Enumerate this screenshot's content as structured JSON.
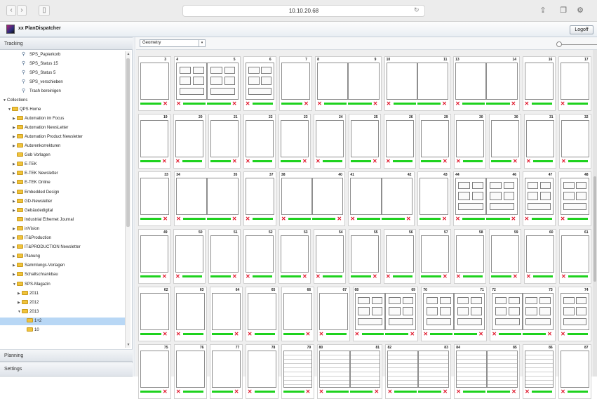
{
  "browser": {
    "back_icon": "back-arrow-icon",
    "forward_icon": "forward-arrow-icon",
    "sidebar_icon": "sidebar-toggle-icon",
    "url": "10.10.20.68",
    "reload_icon": "reload-icon",
    "share_icon": "share-icon",
    "tabs_icon": "tabs-icon",
    "settings_icon": "gear-icon"
  },
  "app": {
    "title": "xx PlanDispatcher",
    "logoff_label": "Logoff"
  },
  "sidebar": {
    "sections": [
      {
        "label": "Tracking"
      },
      {
        "label": "Planning"
      },
      {
        "label": "Settings"
      }
    ],
    "tree": [
      {
        "label": "SPS_Papierkorb",
        "kind": "search",
        "depth": 3
      },
      {
        "label": "SPS_Status 15",
        "kind": "search",
        "depth": 3
      },
      {
        "label": "SPS_Status 5",
        "kind": "search",
        "depth": 3
      },
      {
        "label": "SPS_verschieben",
        "kind": "search",
        "depth": 3
      },
      {
        "label": "Trash bereinigen",
        "kind": "search",
        "depth": 3
      },
      {
        "label": "Collections",
        "kind": "text",
        "depth": 0,
        "arrow": "open"
      },
      {
        "label": "QPS Home",
        "kind": "folder",
        "depth": 1,
        "arrow": "open"
      },
      {
        "label": "Automation im Focus",
        "kind": "folder",
        "depth": 2,
        "arrow": "closed"
      },
      {
        "label": "Automation NewsLetter",
        "kind": "folder",
        "depth": 2,
        "arrow": "closed"
      },
      {
        "label": "Automation Product Newsletter",
        "kind": "folder",
        "depth": 2,
        "arrow": "closed"
      },
      {
        "label": "Autorenkorrekturen",
        "kind": "folder",
        "depth": 2,
        "arrow": "closed"
      },
      {
        "label": "Gob Vorlagen",
        "kind": "folder",
        "depth": 2,
        "arrow": "none"
      },
      {
        "label": "E-TEK",
        "kind": "folder",
        "depth": 2,
        "arrow": "closed"
      },
      {
        "label": "E-TEK Newsletter",
        "kind": "folder",
        "depth": 2,
        "arrow": "closed"
      },
      {
        "label": "E-TEK Online",
        "kind": "folder",
        "depth": 2,
        "arrow": "closed"
      },
      {
        "label": "Embedded Design",
        "kind": "folder",
        "depth": 2,
        "arrow": "closed"
      },
      {
        "label": "GD-Newsletter",
        "kind": "folder",
        "depth": 2,
        "arrow": "closed"
      },
      {
        "label": "Gebäudedigital",
        "kind": "folder",
        "depth": 2,
        "arrow": "closed"
      },
      {
        "label": "Industrial Ethernet Journal",
        "kind": "folder",
        "depth": 2,
        "arrow": "none"
      },
      {
        "label": "inVision",
        "kind": "folder",
        "depth": 2,
        "arrow": "closed"
      },
      {
        "label": "IT&Production",
        "kind": "folder",
        "depth": 2,
        "arrow": "closed"
      },
      {
        "label": "IT&PRODUCTION Newsletter",
        "kind": "folder",
        "depth": 2,
        "arrow": "closed"
      },
      {
        "label": "Planung",
        "kind": "folder",
        "depth": 2,
        "arrow": "closed"
      },
      {
        "label": "Sammlungs-Vorlagen",
        "kind": "folder",
        "depth": 2,
        "arrow": "closed"
      },
      {
        "label": "Schaltschrankbau",
        "kind": "folder",
        "depth": 2,
        "arrow": "closed"
      },
      {
        "label": "SPS-Magazin",
        "kind": "folder",
        "depth": 2,
        "arrow": "open"
      },
      {
        "label": "2011",
        "kind": "folder",
        "depth": 3,
        "arrow": "closed"
      },
      {
        "label": "2012",
        "kind": "folder",
        "depth": 3,
        "arrow": "closed"
      },
      {
        "label": "2013",
        "kind": "folder",
        "depth": 3,
        "arrow": "open"
      },
      {
        "label": "1+2",
        "kind": "folder",
        "depth": 4,
        "arrow": "none",
        "selected": true
      },
      {
        "label": "10",
        "kind": "folder",
        "depth": 4,
        "arrow": "none"
      }
    ]
  },
  "toolbar": {
    "view_mode": "Geometry",
    "dropdown_icon": "chevron-down-icon",
    "zoom_slider_value": 0
  },
  "spread_rows": [
    [
      {
        "labels": [
          "3"
        ],
        "pages": 1,
        "ok": [
          true
        ]
      },
      {
        "labels": [
          "4",
          "5"
        ],
        "pages": 2,
        "ok": [
          false,
          true
        ],
        "layout": true
      },
      {
        "labels": [
          "6"
        ],
        "pages": 1,
        "ok": [
          false
        ],
        "layout": true
      },
      {
        "labels": [
          "7"
        ],
        "pages": 1,
        "ok": [
          true
        ]
      },
      {
        "labels": [
          "8",
          "9"
        ],
        "pages": 2,
        "ok": [
          false,
          true
        ]
      },
      {
        "labels": [
          "10",
          "11"
        ],
        "pages": 2,
        "ok": [
          false,
          true
        ]
      },
      {
        "labels": [
          "13",
          "14"
        ],
        "pages": 2,
        "ok": [
          false,
          true
        ]
      },
      {
        "labels": [
          "16"
        ],
        "pages": 1,
        "ok": [
          false
        ]
      },
      {
        "labels": [
          "17"
        ],
        "pages": 1,
        "ok": [
          false
        ]
      }
    ],
    [
      {
        "labels": [
          "19"
        ],
        "pages": 1,
        "ok": [
          true
        ]
      },
      {
        "labels": [
          "20"
        ],
        "pages": 1,
        "ok": [
          false
        ]
      },
      {
        "labels": [
          "21"
        ],
        "pages": 1,
        "ok": [
          true
        ]
      },
      {
        "labels": [
          "22"
        ],
        "pages": 1,
        "ok": [
          false
        ]
      },
      {
        "labels": [
          "23"
        ],
        "pages": 1,
        "ok": [
          true
        ]
      },
      {
        "labels": [
          "24"
        ],
        "pages": 1,
        "ok": [
          false
        ]
      },
      {
        "labels": [
          "25"
        ],
        "pages": 1,
        "ok": [
          true
        ]
      },
      {
        "labels": [
          "26"
        ],
        "pages": 1,
        "ok": [
          false
        ]
      },
      {
        "labels": [
          "29"
        ],
        "pages": 1,
        "ok": [
          true
        ]
      },
      {
        "labels": [
          "30"
        ],
        "pages": 1,
        "ok": [
          false
        ]
      },
      {
        "labels": [
          "30"
        ],
        "pages": 1,
        "ok": [
          true
        ]
      },
      {
        "labels": [
          "31"
        ],
        "pages": 1,
        "ok": [
          false
        ]
      },
      {
        "labels": [
          "32"
        ],
        "pages": 1,
        "ok": [
          false
        ]
      }
    ],
    [
      {
        "labels": [
          "33"
        ],
        "pages": 1,
        "ok": [
          true
        ]
      },
      {
        "labels": [
          "34",
          "35"
        ],
        "pages": 2,
        "ok": [
          false,
          true
        ]
      },
      {
        "labels": [
          "37"
        ],
        "pages": 1,
        "ok": [
          false
        ]
      },
      {
        "labels": [
          "38",
          "40"
        ],
        "pages": 2,
        "ok": [
          false,
          true
        ]
      },
      {
        "labels": [
          "41",
          "42"
        ],
        "pages": 2,
        "ok": [
          false,
          true
        ]
      },
      {
        "labels": [
          "43"
        ],
        "pages": 1,
        "ok": [
          true
        ]
      },
      {
        "labels": [
          "44",
          "46"
        ],
        "pages": 2,
        "ok": [
          false,
          true
        ],
        "layout": true
      },
      {
        "labels": [
          "47"
        ],
        "pages": 1,
        "ok": [
          false
        ],
        "layout": true
      },
      {
        "labels": [
          "48"
        ],
        "pages": 1,
        "ok": [
          false
        ],
        "layout": true
      }
    ],
    [
      {
        "labels": [
          "49"
        ],
        "pages": 1,
        "ok": [
          true
        ]
      },
      {
        "labels": [
          "50"
        ],
        "pages": 1,
        "ok": [
          false
        ]
      },
      {
        "labels": [
          "51"
        ],
        "pages": 1,
        "ok": [
          true
        ]
      },
      {
        "labels": [
          "52"
        ],
        "pages": 1,
        "ok": [
          false
        ]
      },
      {
        "labels": [
          "53"
        ],
        "pages": 1,
        "ok": [
          true
        ]
      },
      {
        "labels": [
          "54"
        ],
        "pages": 1,
        "ok": [
          false
        ]
      },
      {
        "labels": [
          "55"
        ],
        "pages": 1,
        "ok": [
          true
        ]
      },
      {
        "labels": [
          "56"
        ],
        "pages": 1,
        "ok": [
          false
        ]
      },
      {
        "labels": [
          "57"
        ],
        "pages": 1,
        "ok": [
          true
        ]
      },
      {
        "labels": [
          "58"
        ],
        "pages": 1,
        "ok": [
          false
        ]
      },
      {
        "labels": [
          "59"
        ],
        "pages": 1,
        "ok": [
          true
        ]
      },
      {
        "labels": [
          "60"
        ],
        "pages": 1,
        "ok": [
          false
        ]
      },
      {
        "labels": [
          "61"
        ],
        "pages": 1,
        "ok": [
          false
        ]
      }
    ],
    [
      {
        "labels": [
          "62"
        ],
        "pages": 1,
        "ok": [
          true
        ]
      },
      {
        "labels": [
          "63"
        ],
        "pages": 1,
        "ok": [
          false
        ]
      },
      {
        "labels": [
          "64"
        ],
        "pages": 1,
        "ok": [
          true
        ]
      },
      {
        "labels": [
          "65"
        ],
        "pages": 1,
        "ok": [
          false
        ]
      },
      {
        "labels": [
          "66"
        ],
        "pages": 1,
        "ok": [
          true
        ]
      },
      {
        "labels": [
          "67"
        ],
        "pages": 1,
        "ok": [
          false
        ]
      },
      {
        "labels": [
          "68",
          "69"
        ],
        "pages": 2,
        "ok": [
          false,
          true
        ],
        "layout": true
      },
      {
        "labels": [
          "70",
          "71"
        ],
        "pages": 2,
        "ok": [
          false,
          true
        ],
        "layout": true
      },
      {
        "labels": [
          "72",
          "73"
        ],
        "pages": 2,
        "ok": [
          false,
          true
        ],
        "layout": true
      },
      {
        "labels": [
          "74"
        ],
        "pages": 1,
        "ok": [
          false
        ],
        "layout": true
      }
    ],
    [
      {
        "labels": [
          "75"
        ],
        "pages": 1,
        "ok": [
          true
        ]
      },
      {
        "labels": [
          "76"
        ],
        "pages": 1,
        "ok": [
          false
        ]
      },
      {
        "labels": [
          "77"
        ],
        "pages": 1,
        "ok": [
          true
        ]
      },
      {
        "labels": [
          "78"
        ],
        "pages": 1,
        "ok": [
          false
        ]
      },
      {
        "labels": [
          "79"
        ],
        "pages": 1,
        "ok": [
          true
        ],
        "ruled": true
      },
      {
        "labels": [
          "80",
          "81"
        ],
        "pages": 2,
        "ok": [
          false,
          true
        ],
        "ruled": true
      },
      {
        "labels": [
          "82",
          "83"
        ],
        "pages": 2,
        "ok": [
          false,
          true
        ],
        "ruled": true
      },
      {
        "labels": [
          "84",
          "85"
        ],
        "pages": 2,
        "ok": [
          false,
          true
        ],
        "ruled": true
      },
      {
        "labels": [
          "86"
        ],
        "pages": 1,
        "ok": [
          false
        ],
        "ruled": true
      },
      {
        "labels": [
          "87"
        ],
        "pages": 1,
        "ok": [
          false
        ]
      }
    ]
  ]
}
